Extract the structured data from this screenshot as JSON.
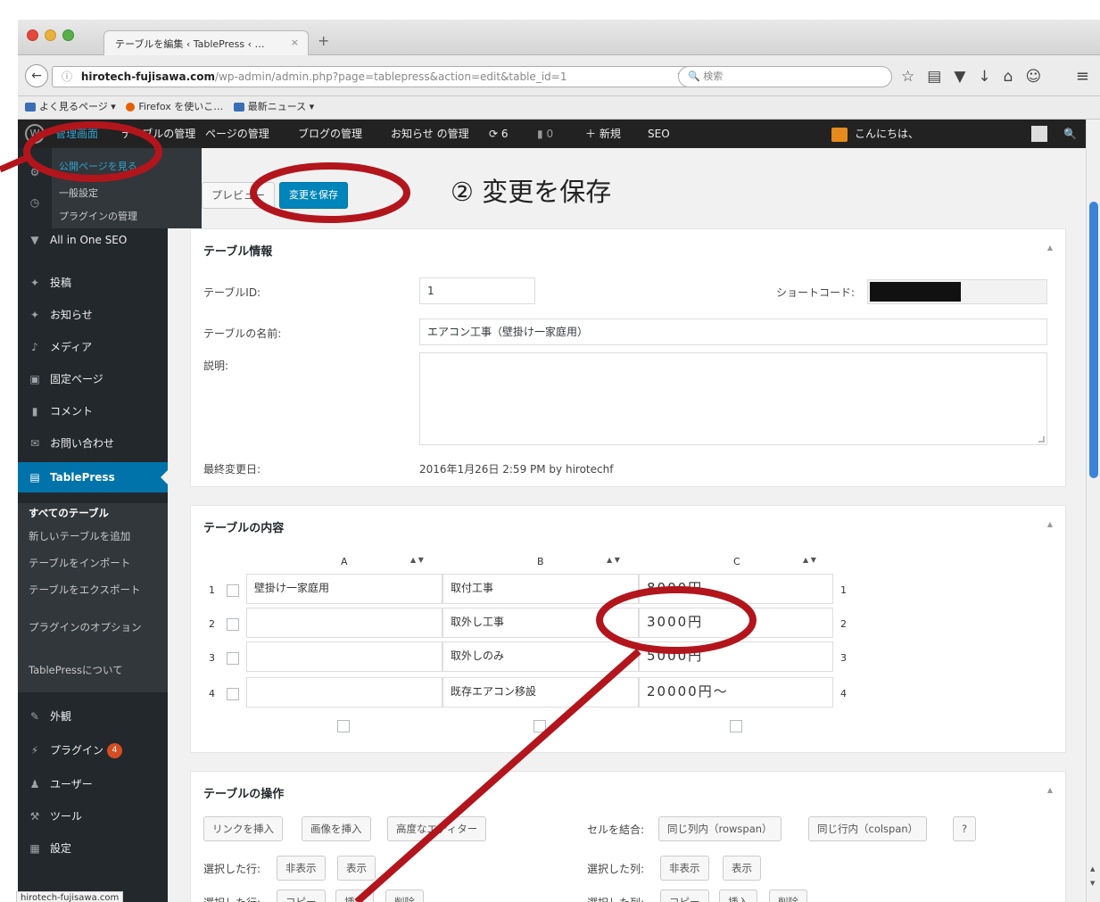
{
  "browser": {
    "tab_title": "テーブルを編集 ‹ TablePress ‹ …",
    "tab_close": "×",
    "new_tab": "+",
    "url_host": "hirotech-fujisawa.com",
    "url_path": "/wp-admin/admin.php?page=tablepress&action=edit&table_id=1",
    "search_placeholder": "検索",
    "bookmarks": [
      "よく見るページ ▾",
      "Firefox を使いこ…",
      "最新ニュース ▾"
    ],
    "status_url": "hirotech-fujisawa.com"
  },
  "adminbar": {
    "item_dashboard": "管理画面",
    "item_table": "テーブルの管理",
    "item_pages": "ページの管理",
    "item_blog": "ブログの管理",
    "item_news": "お知らせ の管理",
    "updates_count": "6",
    "comments_count": "0",
    "new_label": "新規",
    "seo": "SEO",
    "greeting": "こんにちは、"
  },
  "flyout": {
    "items": [
      "公開ページを見る",
      "一般設定",
      "プラグインの管理"
    ]
  },
  "sidebar": {
    "items": [
      {
        "label": "All in One SEO"
      },
      {
        "label": "投稿"
      },
      {
        "label": "お知らせ"
      },
      {
        "label": "メディア"
      },
      {
        "label": "固定ページ"
      },
      {
        "label": "コメント"
      },
      {
        "label": "お問い合わせ"
      },
      {
        "label": "TablePress"
      }
    ],
    "submenu": [
      "すべてのテーブル",
      "新しいテーブルを追加",
      "テーブルをインポート",
      "テーブルをエクスポート",
      "プラグインのオプション",
      "TablePressについて"
    ],
    "lower": [
      {
        "label": "外観"
      },
      {
        "label": "プラグイン"
      },
      {
        "label": "ユーザー"
      },
      {
        "label": "ツール"
      },
      {
        "label": "設定"
      }
    ],
    "plugin_badge": "4"
  },
  "actions": {
    "preview": "プレビュー",
    "save": "変更を保存"
  },
  "annotation": "② 変更を保存",
  "table_info": {
    "title": "テーブル情報",
    "id_label": "テーブルID:",
    "id_value": "1",
    "shortcode_label": "ショートコード:",
    "name_label": "テーブルの名前:",
    "name_value": "エアコン工事（壁掛け一家庭用）",
    "desc_label": "説明:",
    "modified_label": "最終変更日:",
    "modified_value": "2016年1月26日 2:59 PM by hirotechf"
  },
  "table_content": {
    "title": "テーブルの内容",
    "columns": [
      "A",
      "B",
      "C"
    ],
    "rows": [
      {
        "num": "1",
        "a": "壁掛け一家庭用",
        "b": "取付工事",
        "c": "8000円"
      },
      {
        "num": "2",
        "a": "",
        "b": "取外し工事",
        "c": "3000円"
      },
      {
        "num": "3",
        "a": "",
        "b": "取外しのみ",
        "c": "5000円"
      },
      {
        "num": "4",
        "a": "",
        "b": "既存エアコン移設",
        "c": "20000円〜"
      }
    ]
  },
  "table_ops": {
    "title": "テーブルの操作",
    "insert_link": "リンクを挿入",
    "insert_image": "画像を挿入",
    "advanced_editor": "高度なエディター",
    "merge_label": "セルを結合:",
    "merge_rowspan": "同じ列内（rowspan）",
    "merge_colspan": "同じ行内（colspan）",
    "help": "?",
    "selected_rows_label": "選択した行:",
    "selected_cols_label": "選択した列:",
    "hide": "非表示",
    "show": "表示",
    "copy": "コピー",
    "insert": "挿入",
    "delete": "削除"
  },
  "colors": {
    "wp_dark": "#23282d",
    "wp_blue": "#0073aa",
    "annotation_red": "#b3151c"
  }
}
